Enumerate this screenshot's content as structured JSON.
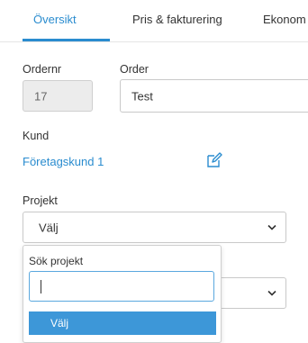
{
  "tabs": [
    {
      "label": "Översikt",
      "active": true
    },
    {
      "label": "Pris & fakturering",
      "active": false
    },
    {
      "label": "Ekonom",
      "active": false
    }
  ],
  "form": {
    "ordernr_label": "Ordernr",
    "ordernr_value": "17",
    "order_label": "Order",
    "order_value": "Test",
    "kund_label": "Kund",
    "kund_value": "Företagskund 1",
    "projekt_label": "Projekt",
    "projekt_value": "Välj"
  },
  "dropdown": {
    "title": "Sök projekt",
    "search_value": "",
    "options": [
      "Välj"
    ]
  },
  "colors": {
    "accent": "#2a8ccf",
    "highlight": "#3d97d8",
    "readonly_bg": "#ececec"
  },
  "icons": [
    "edit-icon",
    "chevron-down-icon"
  ]
}
